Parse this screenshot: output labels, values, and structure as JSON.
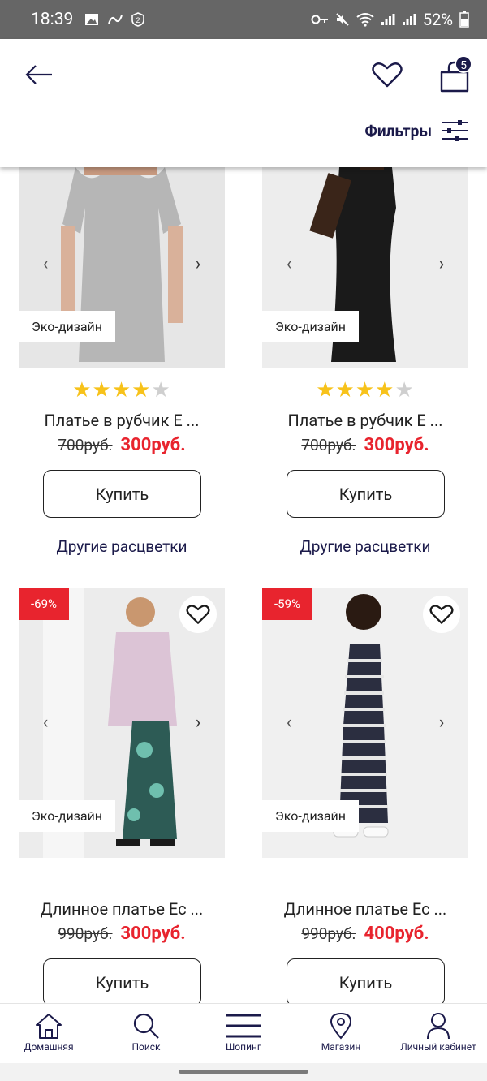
{
  "status_bar": {
    "time": "18:39",
    "battery": "52%",
    "icons_left": [
      "image-icon",
      "nfc-icon",
      "two-badge-icon"
    ],
    "icons_right": [
      "key-icon",
      "mute-icon",
      "wifi-icon",
      "signal-icon",
      "signal-icon",
      "battery-icon"
    ]
  },
  "header": {
    "back_icon": "arrow-left-icon",
    "wishlist_icon": "heart-icon",
    "cart_icon": "shopping-bag-icon",
    "cart_count": "5",
    "filter_label": "Фильтры",
    "filter_icon": "sliders-icon"
  },
  "products": [
    {
      "eco_label": "Эко-дизайн",
      "rating": 4,
      "name": "Платье в рубчик Е ...",
      "old_price": "700руб.",
      "new_price": "300руб.",
      "buy_label": "Купить",
      "other_colors": "Другие расцветки",
      "image_desc": "grey ribbed dress"
    },
    {
      "eco_label": "Эко-дизайн",
      "rating": 4,
      "name": "Платье в рубчик Е ...",
      "old_price": "700руб.",
      "new_price": "300руб.",
      "buy_label": "Купить",
      "other_colors": "Другие расцветки",
      "image_desc": "black ribbed dress"
    },
    {
      "discount": "-69%",
      "eco_label": "Эко-дизайн",
      "name": "Длинное платье Ec ...",
      "old_price": "990руб.",
      "new_price": "300руб.",
      "buy_label": "Купить",
      "image_desc": "long floral dress"
    },
    {
      "discount": "-59%",
      "eco_label": "Эко-дизайн",
      "name": "Длинное платье Ec ...",
      "old_price": "990руб.",
      "new_price": "400руб.",
      "buy_label": "Купить",
      "image_desc": "long striped dress"
    }
  ],
  "bottom_nav": [
    {
      "label": "Домашняя",
      "icon": "home-icon"
    },
    {
      "label": "Поиск",
      "icon": "search-icon"
    },
    {
      "label": "Шопинг",
      "icon": "menu-icon"
    },
    {
      "label": "Магазин",
      "icon": "location-pin-icon"
    },
    {
      "label": "Личный кабинет",
      "icon": "user-icon"
    }
  ],
  "colors": {
    "brand_navy": "#1b1a4a",
    "sale_red": "#e8242e",
    "star_yellow": "#f7c21a",
    "status_bar": "#666666"
  }
}
